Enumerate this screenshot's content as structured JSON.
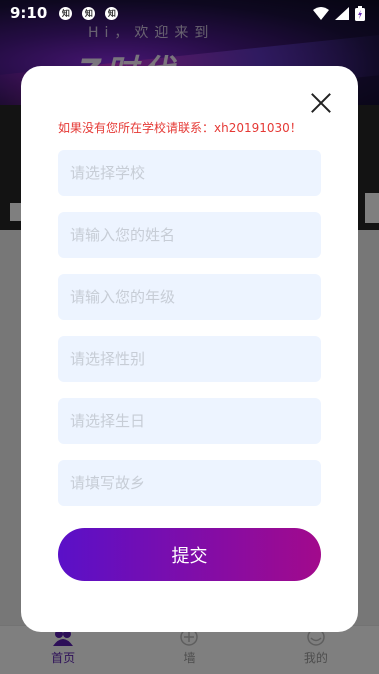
{
  "status_bar": {
    "time": "9:10",
    "notifications": [
      "知",
      "知",
      "知"
    ]
  },
  "banner": {
    "greeting": "Hi，欢迎来到",
    "title": "Z时代"
  },
  "bottom_nav": {
    "items": [
      {
        "label": "首页",
        "icon": "home-icon",
        "active": true
      },
      {
        "label": "墙",
        "icon": "plus-circle-icon",
        "active": false
      },
      {
        "label": "我的",
        "icon": "user-icon",
        "active": false
      }
    ]
  },
  "modal": {
    "notice": "如果没有您所在学校请联系：xh20191030！",
    "fields": {
      "school": "请选择学校",
      "name": "请输入您的姓名",
      "grade": "请输入您的年级",
      "gender": "请选择性别",
      "birthday": "请选择生日",
      "hometown": "请填写故乡"
    },
    "submit_label": "提交"
  },
  "colors": {
    "accent_start": "#5a10c8",
    "accent_end": "#a20a8c",
    "notice": "#e53935",
    "field_bg": "#edf4ff"
  }
}
